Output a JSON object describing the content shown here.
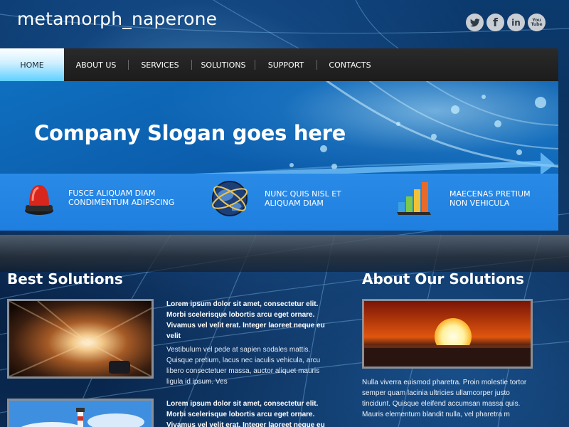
{
  "header": {
    "site_title": "metamorph_naperone",
    "social": [
      {
        "name": "twitter-icon"
      },
      {
        "name": "facebook-icon",
        "glyph": "f"
      },
      {
        "name": "linkedin-icon",
        "glyph": "in"
      },
      {
        "name": "youtube-icon",
        "glyph": "You Tube"
      }
    ]
  },
  "nav": {
    "items": [
      {
        "label": "HOME",
        "active": true
      },
      {
        "label": "ABOUT US"
      },
      {
        "label": "SERVICES"
      },
      {
        "label": "SOLUTIONS"
      },
      {
        "label": "SUPPORT"
      },
      {
        "label": "CONTACTS"
      }
    ]
  },
  "banner": {
    "slogan": "Company Slogan goes here",
    "features": [
      {
        "icon": "siren-icon",
        "line1": "FUSCE ALIQUAM DIAM",
        "line2": "CONDIMENTUM ADIPSCING"
      },
      {
        "icon": "globe-icon",
        "line1": "NUNC QUIS NISL ET",
        "line2": "ALIQUAM DIAM"
      },
      {
        "icon": "bar-chart-icon",
        "line1": "MAECENAS PRETIUM",
        "line2": "NON VEHICULA"
      }
    ]
  },
  "best": {
    "title": "Best Solutions",
    "items": [
      {
        "bold": "Lorem ipsum dolor sit amet, consectetur elit. Morbi scelerisque lobortis arcu eget ornare. Vivamus vel velit erat. Integer laoreet neque eu velit",
        "text": "Vestibulum vel pede at sapien sodales mattis. Quisque pretium, lacus nec iaculis vehicula, arcu libero consectetuer massa, auctor aliquet mauris ligula id ipsum. Ves"
      },
      {
        "bold": "Lorem ipsum dolor sit amet, consectetur elit. Morbi scelerisque lobortis arcu eget ornare. Vivamus vel velit erat. Integer laoreet neque eu velit",
        "text": ""
      }
    ]
  },
  "about": {
    "title": "About Our Solutions",
    "text": "Nulla viverra euismod pharetra. Proin molestie tortor semper quam lacinia ultricies ullamcorper justo tincidunt. Quisque eleifend accumsan massa quis. Mauris elementum blandit nulla, vel pharetra m"
  },
  "colors": {
    "nav_bg": "#1c1c1c",
    "nav_active": "#5ed0ff",
    "banner_blue": "#1e7fe0",
    "social_icon": "#c9ced4"
  }
}
